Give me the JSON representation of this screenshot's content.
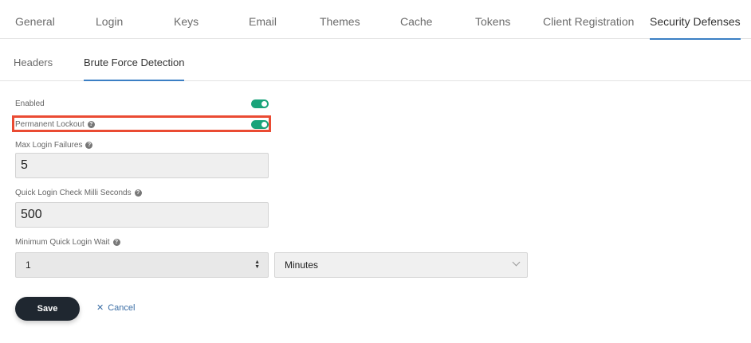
{
  "tabs": [
    "General",
    "Login",
    "Keys",
    "Email",
    "Themes",
    "Cache",
    "Tokens",
    "Client Registration",
    "Security Defenses"
  ],
  "active_tab": "Security Defenses",
  "subtabs": [
    "Headers",
    "Brute Force Detection"
  ],
  "active_subtab": "Brute Force Detection",
  "form": {
    "enabled": {
      "label": "Enabled",
      "value": true
    },
    "permanent_lockout": {
      "label": "Permanent Lockout",
      "value": true
    },
    "max_login_failures": {
      "label": "Max Login Failures",
      "value": "5"
    },
    "quick_login_check": {
      "label": "Quick Login Check Milli Seconds",
      "value": "500"
    },
    "min_quick_login_wait": {
      "label": "Minimum Quick Login Wait",
      "value": "1",
      "unit": "Minutes"
    }
  },
  "buttons": {
    "save": "Save",
    "cancel": "Cancel"
  },
  "colors": {
    "accent": "#3b7fc4",
    "toggle_on": "#1aa37a",
    "highlight": "#ea4b33",
    "save_bg": "#1f2730"
  }
}
